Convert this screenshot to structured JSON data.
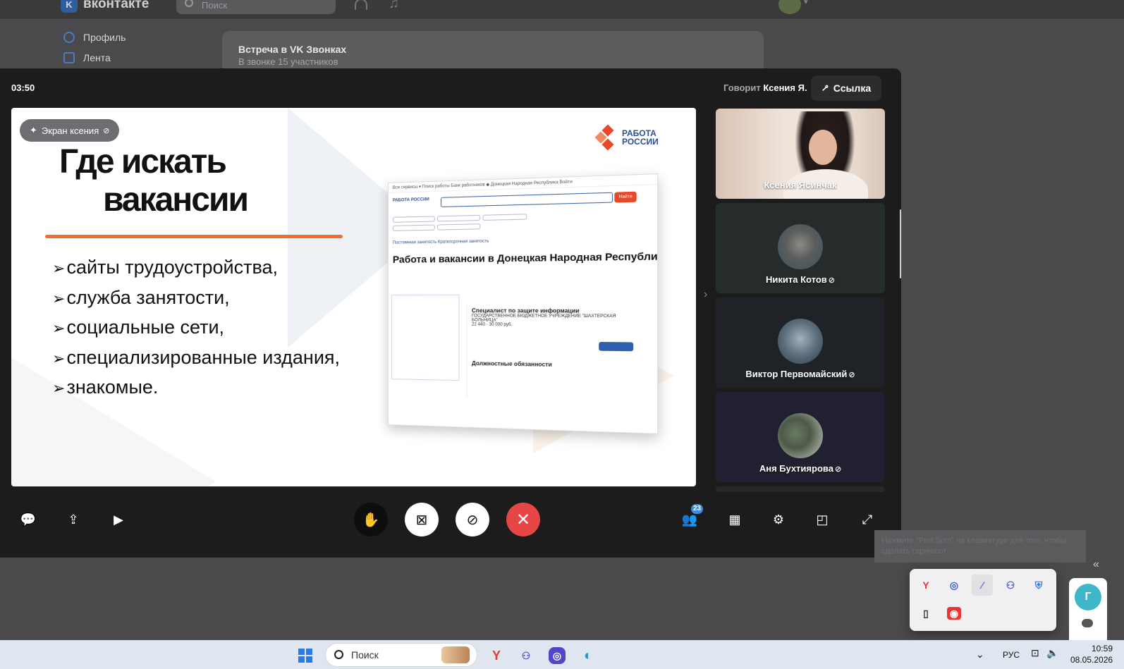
{
  "vk": {
    "logo_letter": "K",
    "logo_text": "вконтакте",
    "search_placeholder": "Поиск",
    "sidebar": [
      {
        "label": "Профиль",
        "icon": "profile-icon"
      },
      {
        "label": "Лента",
        "icon": "feed-icon"
      }
    ],
    "card": {
      "title": "Встреча в VK Звонках",
      "subtitle": "В звонке 15 участников"
    }
  },
  "call": {
    "timer": "03:50",
    "speaking_label": "Говорит",
    "speaker": "Ксения Я.",
    "link_label": "Ссылка",
    "screen_label": "Экран ксения",
    "participants": [
      {
        "name": "Ксения Ясинчак",
        "muted": false,
        "type": "camera"
      },
      {
        "name": "Никита Котов",
        "muted": true,
        "type": "avatar"
      },
      {
        "name": "Виктор Первомайский",
        "muted": true,
        "type": "avatar"
      },
      {
        "name": "Аня Бухтиярова",
        "muted": true,
        "type": "avatar"
      }
    ],
    "participants_count": "23"
  },
  "slide": {
    "title_line1": "Где искать",
    "title_line2": "вакансии",
    "bullets": [
      "сайты трудоустройства,",
      "служба занятости,",
      "социальные сети,",
      "специализированные издания,",
      "знакомые."
    ],
    "logo_line1": "РАБОТА",
    "logo_line2": "РОССИИ",
    "site": {
      "nav": "Все сервисы ▾   Поиск работы   Банк работников   ◆ Донецкая Народная Республика   Войти",
      "logo": "РАБОТА РОССИИ",
      "search_btn": "Найти",
      "tabs": "Постоянная занятость     Краткосрочная занятость",
      "heading": "Работа и вакансии в Донецкая Народная Республика",
      "card_title": "Специалист по защите информации",
      "card_org": "ГОСУДАРСТВЕННОЕ БЮДЖЕТНОЕ УЧРЕЖДЕНИЕ \"ШАХТЕРСКАЯ БОЛЬНИЦА\"",
      "card_salary": "22 440 - 30 000 руб.",
      "card_section": "Должностные обязанности"
    }
  },
  "tooltip": "Нажмите \"Prnt Scrn\" на клавиатуре для того, чтобы сделать скриншот",
  "agent_letter": "Г",
  "taskbar": {
    "search_placeholder": "Поиск",
    "lang": "РУС",
    "time": "10:59",
    "date": "08.05.2026"
  },
  "colors": {
    "end_call": "#e64646",
    "accent": "#3f8ae0",
    "slide_underline": "#ec6f2c",
    "brand_blue": "#2b4f93"
  }
}
